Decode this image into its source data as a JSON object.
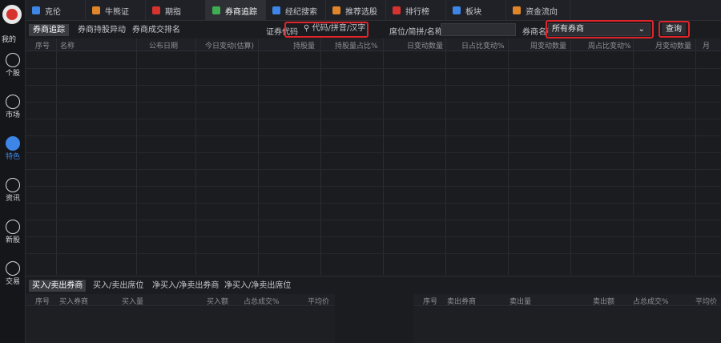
{
  "sidebar": {
    "top_label": "我的",
    "items": [
      {
        "label": "个股",
        "icon": "stock-chart-icon"
      },
      {
        "label": "市场",
        "icon": "market-trend-icon"
      },
      {
        "label": "特色",
        "icon": "feature-icon"
      },
      {
        "label": "资讯",
        "icon": "news-icon"
      },
      {
        "label": "新股",
        "icon": "ipo-icon"
      },
      {
        "label": "交易",
        "icon": "trade-icon"
      }
    ]
  },
  "tabs": [
    {
      "label": "克伦",
      "color": "#3d86e8"
    },
    {
      "label": "牛熊证",
      "color": "#e0862a"
    },
    {
      "label": "期指",
      "color": "#d6332f"
    },
    {
      "label": "券商追踪",
      "color": "#3fae52"
    },
    {
      "label": "经纪搜索",
      "color": "#3d86e8"
    },
    {
      "label": "推荐选股",
      "color": "#e0862a"
    },
    {
      "label": "排行榜",
      "color": "#d6332f"
    },
    {
      "label": "板块",
      "color": "#3d86e8"
    },
    {
      "label": "资金流向",
      "color": "#e0862a"
    }
  ],
  "filter": {
    "subtabs": [
      "券商追踪",
      "券商持股异动",
      "券商成交排名"
    ],
    "code_label": "证券代码",
    "code_placeholder": "代码/拼音/汉字",
    "seat_label": "席位/简拼/名称",
    "broker_label": "券商名称",
    "broker_value": "所有券商",
    "query_button": "查询"
  },
  "main_table": {
    "headers": [
      "序号",
      "名称",
      "公布日期",
      "今日变动(估算)",
      "持股量",
      "持股量占比%",
      "日变动数量",
      "日占比变动%",
      "周变动数量",
      "周占比变动%",
      "月变动数量",
      "月"
    ]
  },
  "bottom": {
    "tabs": [
      "买入/卖出券商",
      "买入/卖出席位",
      "净买入/净卖出券商",
      "净买入/净卖出席位"
    ],
    "left_headers": [
      "序号",
      "买入券商",
      "买入量",
      "买入额",
      "占总成交%",
      "平均价"
    ],
    "right_headers": [
      "序号",
      "卖出券商",
      "卖出量",
      "卖出额",
      "占总成交%",
      "平均价"
    ]
  }
}
